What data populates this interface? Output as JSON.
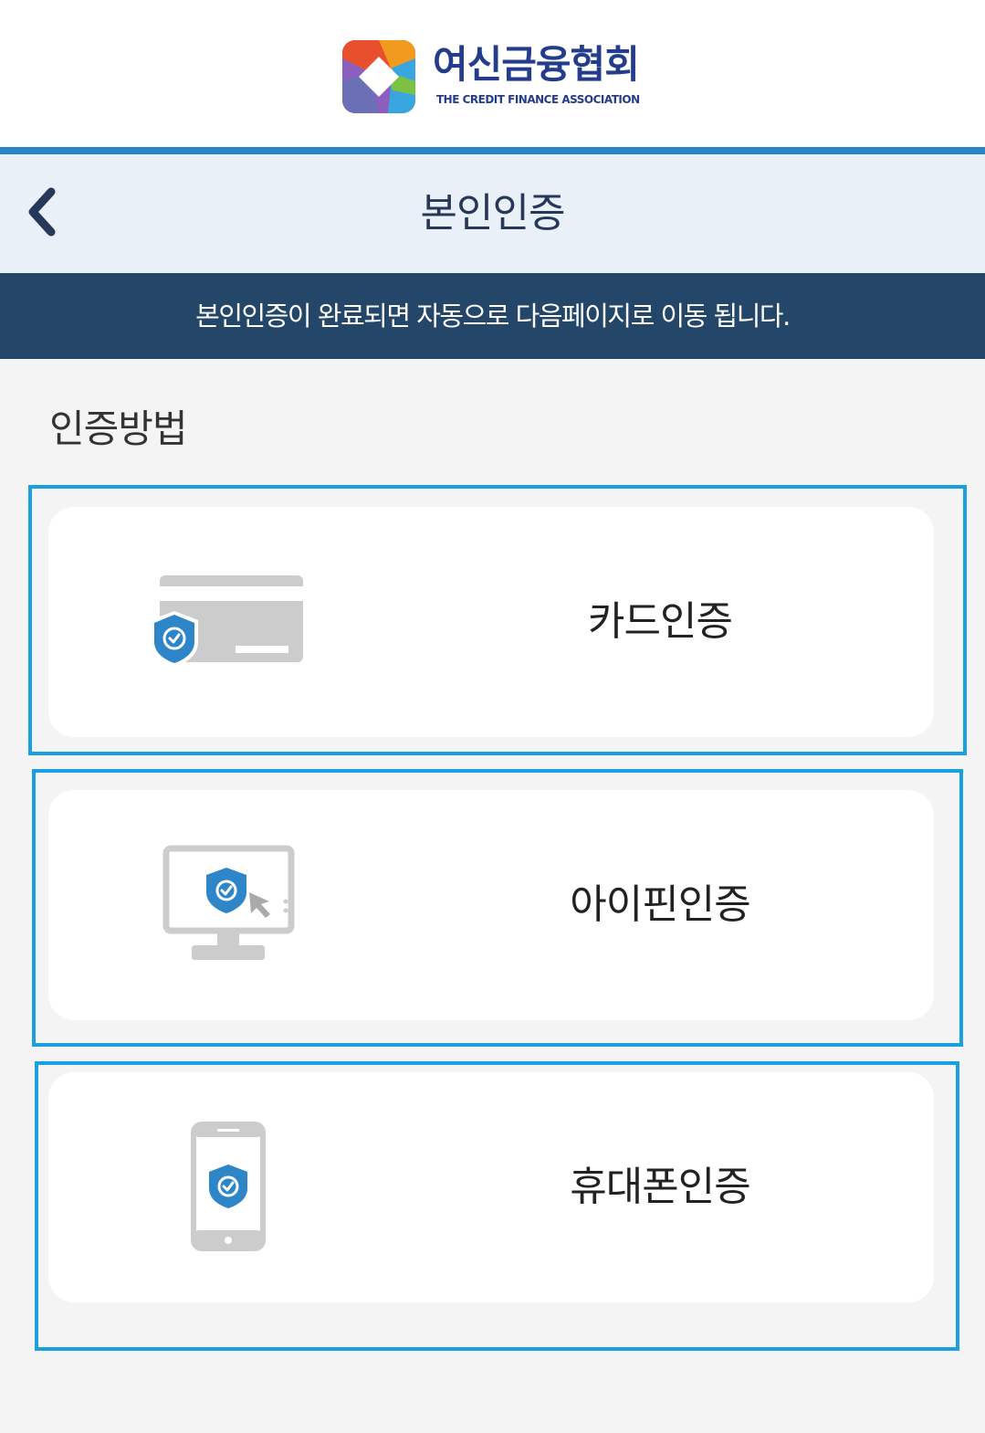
{
  "header": {
    "logo_name": "여신금융협회",
    "logo_sub": "THE CREDIT FINANCE ASSOCIATION"
  },
  "titlebar": {
    "back_icon": "chevron-left-icon",
    "title": "본인인증"
  },
  "notice": {
    "text": "본인인증이 완료되면 자동으로 다음페이지로 이동 됩니다."
  },
  "section": {
    "title": "인증방법"
  },
  "methods": [
    {
      "label": "카드인증",
      "icon": "card-shield-icon"
    },
    {
      "label": "아이핀인증",
      "icon": "monitor-shield-icon"
    },
    {
      "label": "휴대폰인증",
      "icon": "phone-shield-icon"
    }
  ],
  "colors": {
    "accent_border": "#2b86c8",
    "notice_bg": "#244669",
    "highlight": "#1aa1dd",
    "shield": "#2e86c8"
  }
}
